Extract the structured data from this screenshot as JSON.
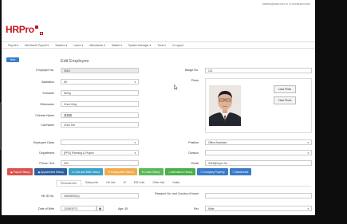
{
  "header": {
    "logo_text": "HRPro",
    "user_info": "HRPRO@HRPLUS1.T1 | 5.SUNSHIFO.PRO"
  },
  "nav": {
    "items": [
      "Payroll ▾",
      "Mid-Month Payroll ▾",
      "Taxation ▾",
      "Leave ▾",
      "Attendance ▾",
      "Master ▾",
      "System Manager ▾",
      "Tools ▾",
      "⏻ Logout"
    ]
  },
  "toolbar": {
    "new_label": "New"
  },
  "page": {
    "title": "Edit Employee"
  },
  "form": {
    "employee_no": {
      "label": "Employee No.",
      "value": "3018"
    },
    "salutation": {
      "label": "Salutation",
      "value": "Mr"
    },
    "surname": {
      "label": "Surname",
      "value": "Wong"
    },
    "othername": {
      "label": "Othername",
      "value": "Chun Hing"
    },
    "chinese_name": {
      "label": "Chinese Name",
      "value": "黃振興"
    },
    "call_name": {
      "label": "Call Name",
      "value": "Chun Hin"
    },
    "badge_no": {
      "label": "Badge No.",
      "value": "221"
    },
    "photo": {
      "label": "Photo",
      "load_label": "Load Photo",
      "clear_label": "Clear Photo"
    },
    "employee_class": {
      "label": "Employee Class",
      "value": ""
    },
    "department": {
      "label": "Department",
      "value": "[PPD] Planning & Project"
    },
    "phone_ext": {
      "label": "Phone / Ext",
      "value": "000"
    },
    "position": {
      "label": "Position",
      "value": "Office Assistant"
    },
    "division": {
      "label": "Division",
      "value": ""
    },
    "email": {
      "label": "Email",
      "value": "3018@hrpro.hk"
    }
  },
  "section_tabs": [
    {
      "label": "▣ Payroll History",
      "color": "#d9534f"
    },
    {
      "label": "▣ Appointment History",
      "color": "#2f5f9c"
    },
    {
      "label": "✆ Cost and Skills History",
      "color": "#3aa1c9"
    },
    {
      "label": "⚑ Employment History",
      "color": "#f0ad4e"
    },
    {
      "label": "⚑ Leave History",
      "color": "#5cb85c"
    },
    {
      "label": "◷ Attendance History",
      "color": "#4cae4c"
    },
    {
      "label": "☰ Company Property",
      "color": "#3a7bc8"
    },
    {
      "label": "❐ Attachment",
      "color": "#3a7bc8"
    }
  ],
  "sub_tabs": [
    "Personal Info",
    "Salary Info",
    "HK Info",
    "SI",
    "ESH Info",
    "Other Info",
    "Notes"
  ],
  "personal": {
    "hkid": {
      "label": "HK ID No.",
      "value": "V6848932(4)"
    },
    "passport": {
      "label": "Passport No. and Country of Issue",
      "value": ""
    },
    "dob": {
      "label": "Date of Birth",
      "value": "13/06/1973"
    },
    "age": {
      "label": "Age",
      "value": "45"
    },
    "sex": {
      "label": "Sex",
      "value": "Male"
    }
  }
}
